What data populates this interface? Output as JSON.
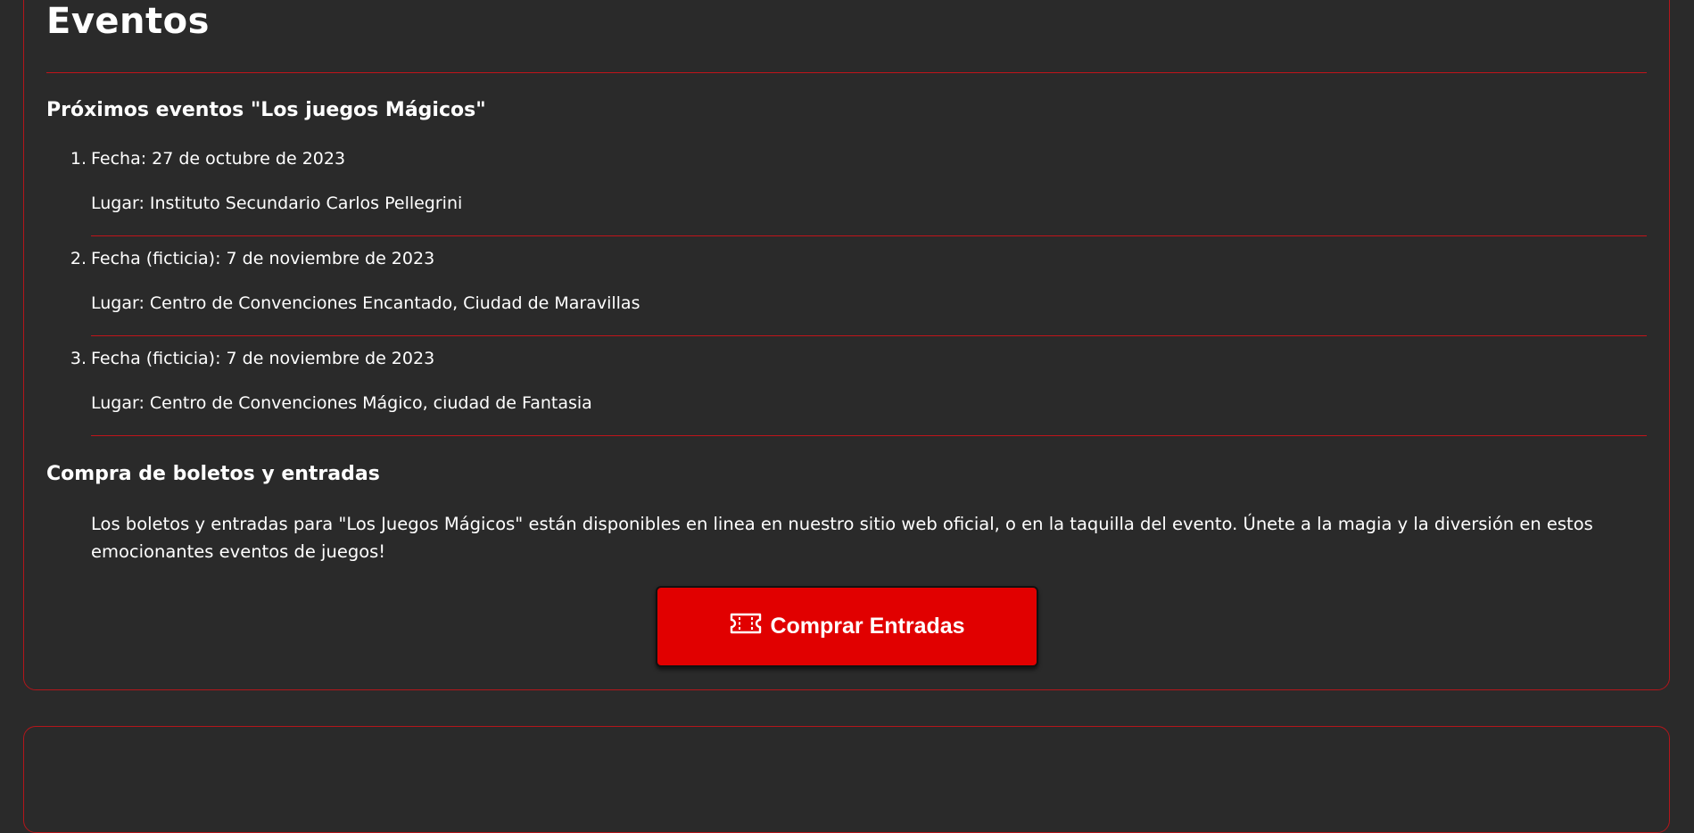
{
  "page_title": "Eventos",
  "upcoming": {
    "heading": "Próximos eventos \"Los juegos Mágicos\"",
    "items": [
      {
        "number": "1.",
        "date": "Fecha: 27 de octubre de 2023",
        "place": "Lugar: Instituto Secundario Carlos Pellegrini"
      },
      {
        "number": "2.",
        "date": "Fecha (ficticia): 7 de noviembre de 2023",
        "place": "Lugar: Centro de Convenciones Encantado, Ciudad de Maravillas"
      },
      {
        "number": "3.",
        "date": "Fecha (ficticia): 7 de noviembre de 2023",
        "place": "Lugar: Centro de Convenciones Mágico, ciudad de Fantasia"
      }
    ]
  },
  "tickets": {
    "heading": "Compra de boletos y entradas",
    "text": "Los boletos y entradas para \"Los Juegos Mágicos\" están disponibles en linea en nuestro sitio web oficial, o en la taquilla del evento. Únete a la magia y la diversión en estos emocionantes eventos de juegos!",
    "button_label": "Comprar Entradas",
    "button_icon": "ticket-icon"
  },
  "colors": {
    "background": "#2a2a2a",
    "accent": "#c0141a",
    "button": "#e10000",
    "text": "#ffffff"
  }
}
